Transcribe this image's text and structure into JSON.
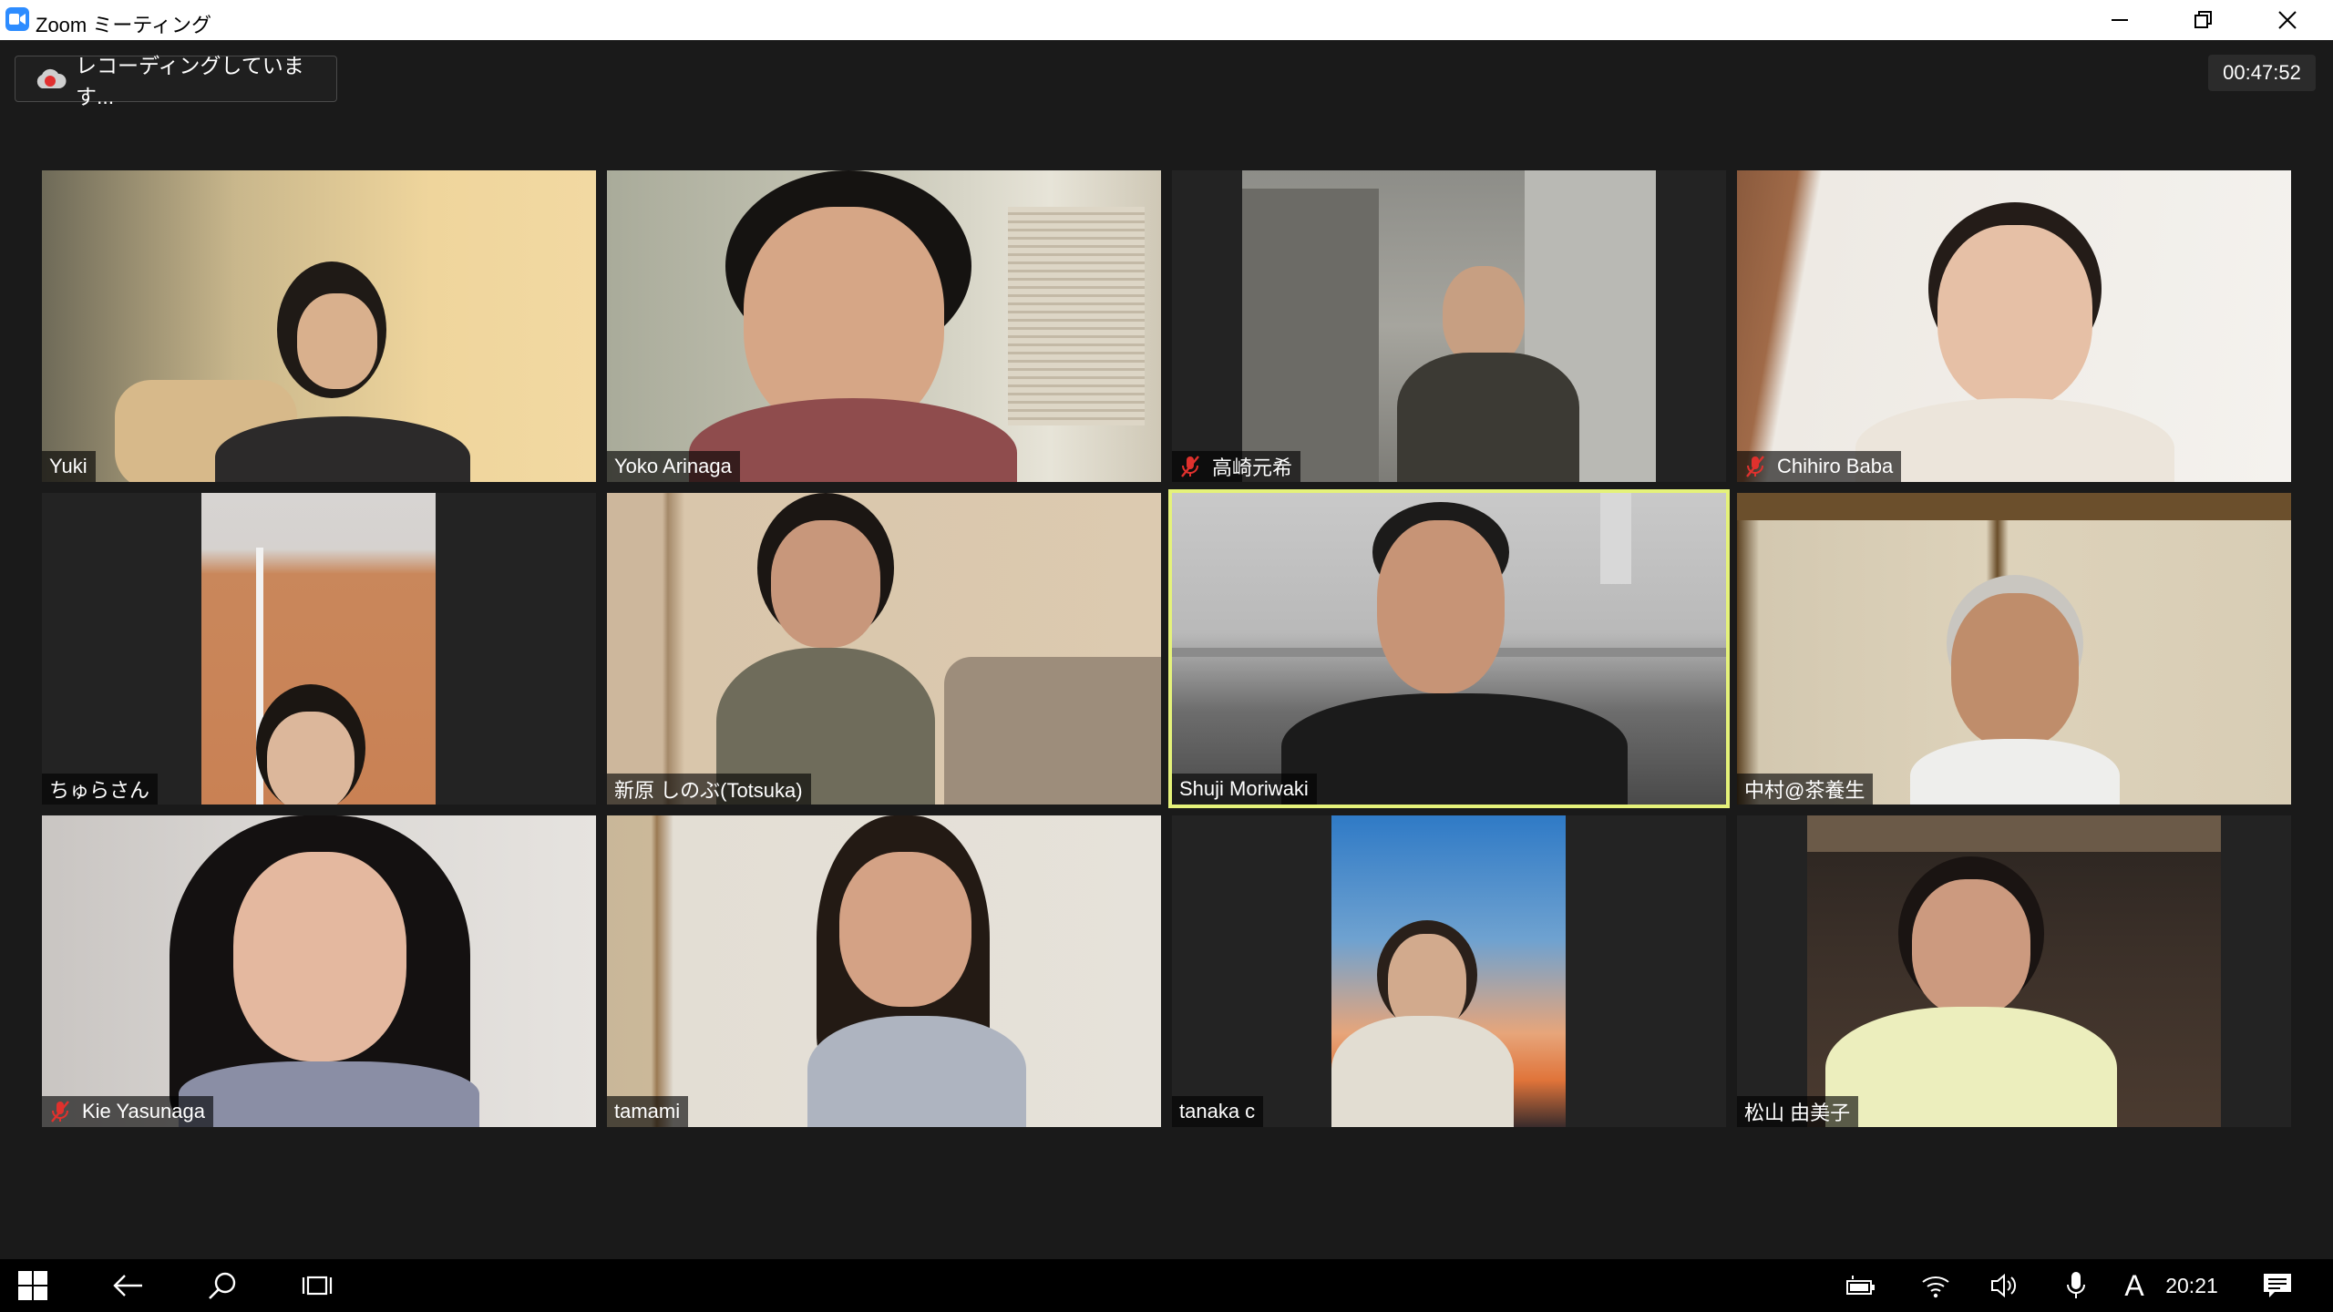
{
  "window": {
    "title": "Zoom ミーティング",
    "icon": "zoom-camera-icon",
    "controls": [
      "minimize-icon",
      "restore-icon",
      "close-icon"
    ]
  },
  "meeting": {
    "recording_label": "レコーディングしています...",
    "recording_icon": "cloud-record-icon",
    "elapsed": "00:47:52",
    "active_speaker_color": "#e5f27a"
  },
  "participants": [
    {
      "name": "Yuki",
      "muted": false
    },
    {
      "name": "Yoko Arinaga",
      "muted": false
    },
    {
      "name": "高崎元希",
      "muted": true
    },
    {
      "name": "Chihiro Baba",
      "muted": true
    },
    {
      "name": "ちゅらさん",
      "muted": false
    },
    {
      "name": "新原 しのぶ(Totsuka)",
      "muted": false
    },
    {
      "name": "Shuji Moriwaki",
      "muted": false,
      "active_speaker": true
    },
    {
      "name": "中村@茶養生",
      "muted": false
    },
    {
      "name": "Kie Yasunaga",
      "muted": true
    },
    {
      "name": "tamami",
      "muted": false
    },
    {
      "name": "tanaka c",
      "muted": false
    },
    {
      "name": "松山 由美子",
      "muted": false
    }
  ],
  "taskbar": {
    "left_icons": [
      "windows-start-icon",
      "back-arrow-icon",
      "search-icon",
      "task-view-icon"
    ],
    "tray_icons": [
      "battery-icon",
      "wifi-icon",
      "volume-icon",
      "microphone-icon",
      "ime-icon"
    ],
    "ime_label": "A",
    "clock": "20:21",
    "notification_icon": "action-center-icon"
  }
}
